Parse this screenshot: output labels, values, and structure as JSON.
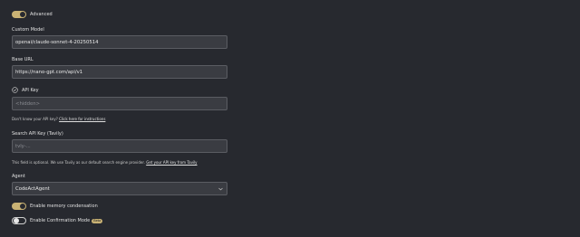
{
  "advanced": {
    "label": "Advanced",
    "enabled": true
  },
  "custom_model": {
    "label": "Custom Model",
    "value": "openai/claude-sonnet-4-20250514"
  },
  "base_url": {
    "label": "Base URL",
    "value": "https://nano-gpt.com/api/v1"
  },
  "api_key": {
    "label": "API Key",
    "placeholder": "<hidden>",
    "helper_text": "Don't know your API key?",
    "helper_link": "Click here for instructions",
    "status_icon": "check-circle-icon"
  },
  "search_api_key": {
    "label": "Search API Key (Tavily)",
    "placeholder": "tvly-...",
    "helper_text": "This field is optional. We use Tavily as our default search engine provider.",
    "helper_link": "Get your API key from Tavily"
  },
  "agent": {
    "label": "Agent",
    "value": "CodeActAgent",
    "caret_icon": "chevron-down-icon"
  },
  "memory_condensation": {
    "label": "Enable memory condensation",
    "enabled": true
  },
  "confirmation_mode": {
    "label": "Enable Confirmation Mode",
    "enabled": false,
    "badge": "Beta"
  },
  "colors": {
    "background": "#27292f",
    "input_background": "#3a3c42",
    "accent": "#c9b274"
  }
}
